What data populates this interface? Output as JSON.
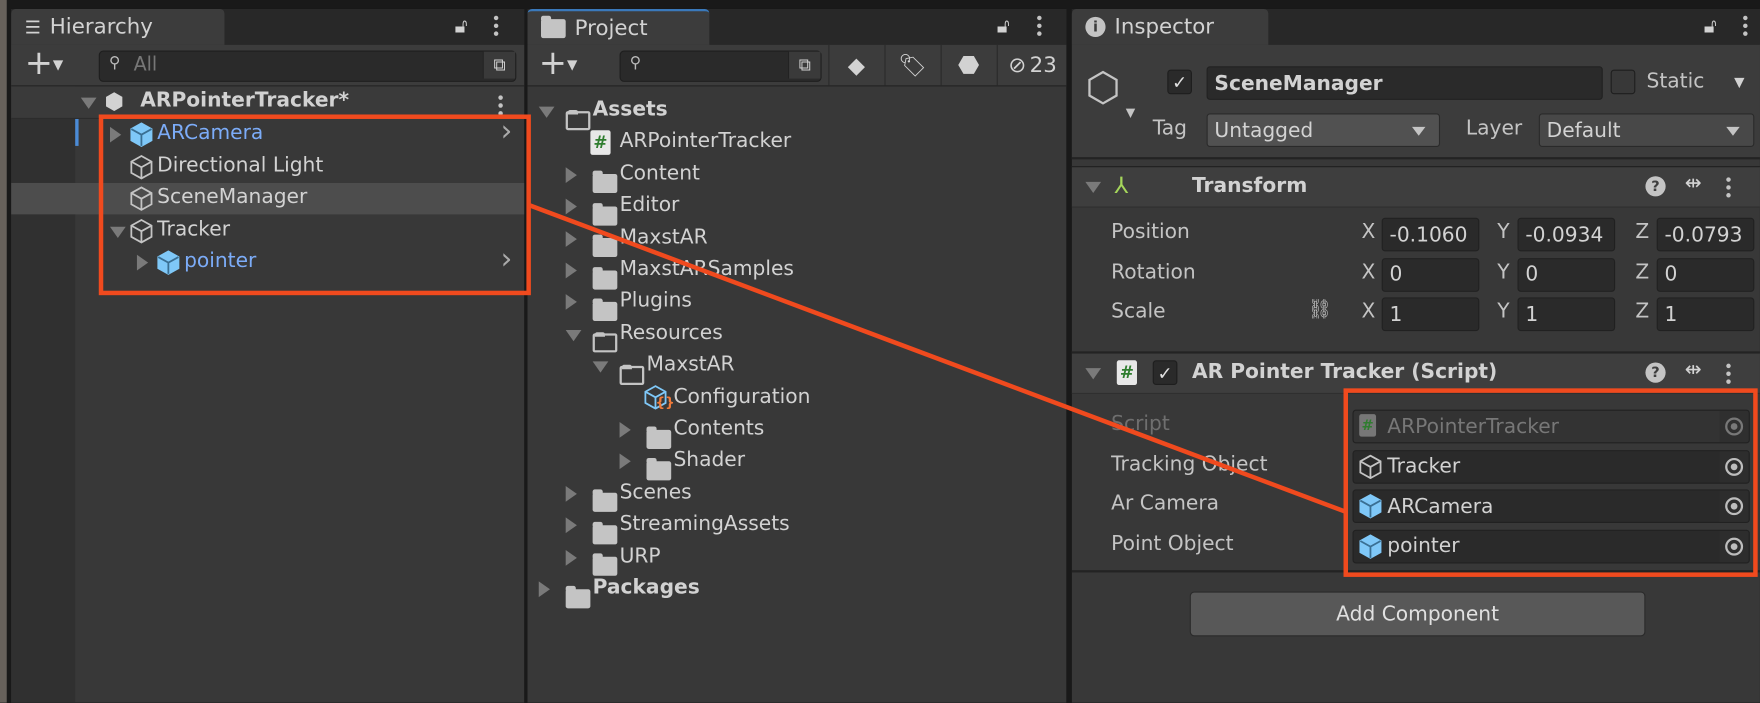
{
  "hierarchy": {
    "tab_label": "Hierarchy",
    "search_placeholder": "All",
    "scene": "ARPointerTracker*",
    "items": [
      {
        "label": "ARCamera",
        "prefab": true,
        "expand": "collapsed",
        "indent": 0,
        "chevron": true
      },
      {
        "label": "Directional Light",
        "prefab": false,
        "expand": "none",
        "indent": 0
      },
      {
        "label": "SceneManager",
        "prefab": false,
        "expand": "none",
        "indent": 0,
        "selected": true
      },
      {
        "label": "Tracker",
        "prefab": false,
        "expand": "expanded",
        "indent": 0
      },
      {
        "label": "pointer",
        "prefab": true,
        "expand": "collapsed",
        "indent": 1,
        "chevron": true
      }
    ]
  },
  "project": {
    "tab_label": "Project",
    "hidden_count": "23",
    "items": [
      {
        "label": "Assets",
        "type": "folder-open",
        "expand": "expanded",
        "indent": 0,
        "bold": true
      },
      {
        "label": "ARPointerTracker",
        "type": "script",
        "expand": "none",
        "indent": 1
      },
      {
        "label": "Content",
        "type": "folder",
        "expand": "collapsed",
        "indent": 1
      },
      {
        "label": "Editor",
        "type": "folder",
        "expand": "collapsed",
        "indent": 1
      },
      {
        "label": "MaxstAR",
        "type": "folder",
        "expand": "collapsed",
        "indent": 1
      },
      {
        "label": "MaxstARSamples",
        "type": "folder",
        "expand": "collapsed",
        "indent": 1
      },
      {
        "label": "Plugins",
        "type": "folder",
        "expand": "collapsed",
        "indent": 1
      },
      {
        "label": "Resources",
        "type": "folder-open",
        "expand": "expanded",
        "indent": 1
      },
      {
        "label": "MaxstAR",
        "type": "folder-open",
        "expand": "expanded",
        "indent": 2
      },
      {
        "label": "Configuration",
        "type": "config",
        "expand": "none",
        "indent": 3
      },
      {
        "label": "Contents",
        "type": "folder",
        "expand": "collapsed",
        "indent": 3
      },
      {
        "label": "Shader",
        "type": "folder",
        "expand": "collapsed",
        "indent": 3
      },
      {
        "label": "Scenes",
        "type": "folder",
        "expand": "collapsed",
        "indent": 1
      },
      {
        "label": "StreamingAssets",
        "type": "folder",
        "expand": "collapsed",
        "indent": 1
      },
      {
        "label": "URP",
        "type": "folder",
        "expand": "collapsed",
        "indent": 1
      },
      {
        "label": "Packages",
        "type": "folder",
        "expand": "collapsed",
        "indent": 0,
        "bold": true
      }
    ]
  },
  "inspector": {
    "tab_label": "Inspector",
    "object_name": "SceneManager",
    "active": true,
    "static_label": "Static",
    "static": false,
    "tag_label": "Tag",
    "tag_value": "Untagged",
    "layer_label": "Layer",
    "layer_value": "Default",
    "transform": {
      "title": "Transform",
      "rows": [
        {
          "label": "Position",
          "x": "-0.1060",
          "y": "-0.0934",
          "z": "-0.0793"
        },
        {
          "label": "Rotation",
          "x": "0",
          "y": "0",
          "z": "0"
        },
        {
          "label": "Scale",
          "x": "1",
          "y": "1",
          "z": "1"
        }
      ],
      "axis": [
        "X",
        "Y",
        "Z"
      ]
    },
    "script_component": {
      "title": "AR Pointer Tracker (Script)",
      "enabled": true,
      "fields": [
        {
          "label": "Script",
          "value": "ARPointerTracker",
          "icon": "script",
          "disabled": true
        },
        {
          "label": "Tracking Object",
          "value": "Tracker",
          "icon": "gameobject"
        },
        {
          "label": "Ar Camera",
          "value": "ARCamera",
          "icon": "prefab"
        },
        {
          "label": "Point Object",
          "value": "pointer",
          "icon": "prefab"
        }
      ]
    },
    "add_component_label": "Add Component"
  },
  "colors": {
    "highlight": "#f04a1e",
    "prefab_text": "#7cacf8",
    "prefab_icon": "#7fc8f8",
    "panel": "#383838"
  }
}
